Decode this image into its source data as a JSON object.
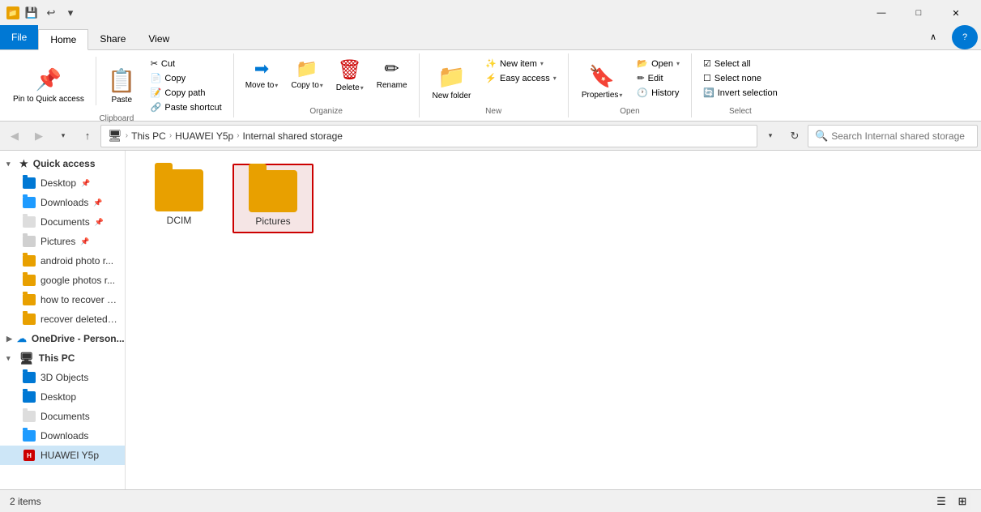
{
  "titlebar": {
    "icon": "📁",
    "qat": [
      "💾",
      "↩",
      "▾"
    ],
    "controls": [
      "—",
      "□",
      "✕"
    ]
  },
  "ribbon": {
    "tabs": [
      "File",
      "Home",
      "Share",
      "View"
    ],
    "active_tab": "Home",
    "groups": {
      "clipboard": {
        "label": "Clipboard",
        "pin_label": "Pin to Quick\naccess",
        "copy_label": "Copy",
        "paste_label": "Paste",
        "cut_label": "Cut",
        "copy_path_label": "Copy path",
        "paste_shortcut_label": "Paste shortcut"
      },
      "organize": {
        "label": "Organize",
        "move_to_label": "Move\nto",
        "copy_to_label": "Copy\nto",
        "delete_label": "Delete",
        "rename_label": "Rename"
      },
      "new": {
        "label": "New",
        "new_folder_label": "New\nfolder",
        "new_item_label": "New item",
        "easy_access_label": "Easy access"
      },
      "open": {
        "label": "Open",
        "properties_label": "Properties",
        "open_label": "Open",
        "edit_label": "Edit",
        "history_label": "History"
      },
      "select": {
        "label": "Select",
        "select_all_label": "Select all",
        "select_none_label": "Select none",
        "invert_label": "Invert selection"
      }
    }
  },
  "navbar": {
    "breadcrumb": [
      "This PC",
      "HUAWEI Y5p",
      "Internal shared storage"
    ],
    "search_placeholder": "Search Internal shared storage"
  },
  "sidebar": {
    "sections": [
      {
        "id": "quick-access",
        "label": "Quick access",
        "expanded": true,
        "items": [
          {
            "id": "desktop-quick",
            "label": "Desktop",
            "pinned": true,
            "type": "blue-folder"
          },
          {
            "id": "downloads-quick",
            "label": "Downloads",
            "pinned": true,
            "type": "dl-folder"
          },
          {
            "id": "documents-quick",
            "label": "Documents",
            "pinned": true,
            "type": "doc-folder"
          },
          {
            "id": "pictures-quick",
            "label": "Pictures",
            "pinned": true,
            "type": "pic-folder"
          },
          {
            "id": "android-photo",
            "label": "android photo r...",
            "pinned": false,
            "type": "yellow-folder"
          },
          {
            "id": "google-photos",
            "label": "google photos r...",
            "pinned": false,
            "type": "yellow-folder"
          },
          {
            "id": "how-to-recover",
            "label": "how to recover e...",
            "pinned": false,
            "type": "yellow-folder"
          },
          {
            "id": "recover-deleted",
            "label": "recover deleted p...",
            "pinned": false,
            "type": "yellow-folder"
          }
        ]
      },
      {
        "id": "onedrive",
        "label": "OneDrive - Person...",
        "expanded": false,
        "items": []
      },
      {
        "id": "this-pc",
        "label": "This PC",
        "expanded": true,
        "items": [
          {
            "id": "3d-objects",
            "label": "3D Objects",
            "pinned": false,
            "type": "blue-folder"
          },
          {
            "id": "desktop-pc",
            "label": "Desktop",
            "pinned": false,
            "type": "blue-folder"
          },
          {
            "id": "documents-pc",
            "label": "Documents",
            "pinned": false,
            "type": "doc-folder"
          },
          {
            "id": "downloads-pc",
            "label": "Downloads",
            "pinned": false,
            "type": "dl-folder"
          },
          {
            "id": "huawei-y5p",
            "label": "HUAWEI Y5p",
            "pinned": false,
            "type": "huawei",
            "selected": true
          }
        ]
      }
    ]
  },
  "content": {
    "items": [
      {
        "id": "dcim",
        "label": "DCIM",
        "selected": false
      },
      {
        "id": "pictures",
        "label": "Pictures",
        "selected": true
      }
    ]
  },
  "statusbar": {
    "count_label": "2 items",
    "help_label": "?"
  }
}
